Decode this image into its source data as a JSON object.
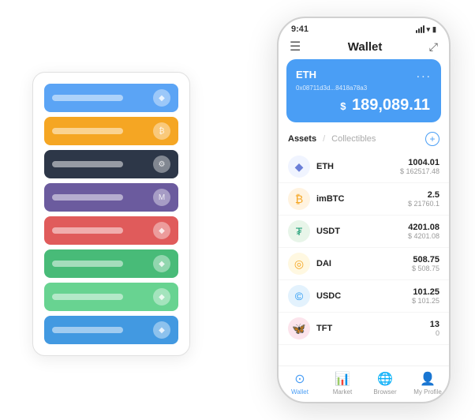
{
  "header": {
    "title": "Wallet",
    "time": "9:41"
  },
  "eth_card": {
    "label": "ETH",
    "address": "0x08711d3d...8418a78a3",
    "address_suffix": "⊞",
    "dots": "...",
    "balance": "$ 189,089.11",
    "currency_symbol": "$"
  },
  "assets": {
    "tab_active": "Assets",
    "tab_divider": "/",
    "tab_inactive": "Collectibles",
    "add_label": "+"
  },
  "asset_list": [
    {
      "name": "ETH",
      "icon": "◆",
      "icon_class": "icon-eth",
      "amount": "1004.01",
      "usd": "$ 162517.48"
    },
    {
      "name": "imBTC",
      "icon": "₿",
      "icon_class": "icon-imbtc",
      "amount": "2.5",
      "usd": "$ 21760.1"
    },
    {
      "name": "USDT",
      "icon": "₮",
      "icon_class": "icon-usdt",
      "amount": "4201.08",
      "usd": "$ 4201.08"
    },
    {
      "name": "DAI",
      "icon": "◎",
      "icon_class": "icon-dai",
      "amount": "508.75",
      "usd": "$ 508.75"
    },
    {
      "name": "USDC",
      "icon": "©",
      "icon_class": "icon-usdc",
      "amount": "101.25",
      "usd": "$ 101.25"
    },
    {
      "name": "TFT",
      "icon": "🦋",
      "icon_class": "icon-tft",
      "amount": "13",
      "usd": "0"
    }
  ],
  "bottom_nav": [
    {
      "id": "wallet",
      "icon": "⊙",
      "label": "Wallet",
      "active": true
    },
    {
      "id": "market",
      "icon": "📊",
      "label": "Market",
      "active": false
    },
    {
      "id": "browser",
      "icon": "🌐",
      "label": "Browser",
      "active": false
    },
    {
      "id": "profile",
      "icon": "👤",
      "label": "My Profile",
      "active": false
    }
  ],
  "card_stack": [
    {
      "color": "card-blue",
      "icon": "◆"
    },
    {
      "color": "card-orange",
      "icon": "₿"
    },
    {
      "color": "card-dark",
      "icon": "⚙"
    },
    {
      "color": "card-purple",
      "icon": "M"
    },
    {
      "color": "card-red",
      "icon": "◆"
    },
    {
      "color": "card-green",
      "icon": "◆"
    },
    {
      "color": "card-lightgreen",
      "icon": "◆"
    },
    {
      "color": "card-cornblue",
      "icon": "◆"
    }
  ]
}
